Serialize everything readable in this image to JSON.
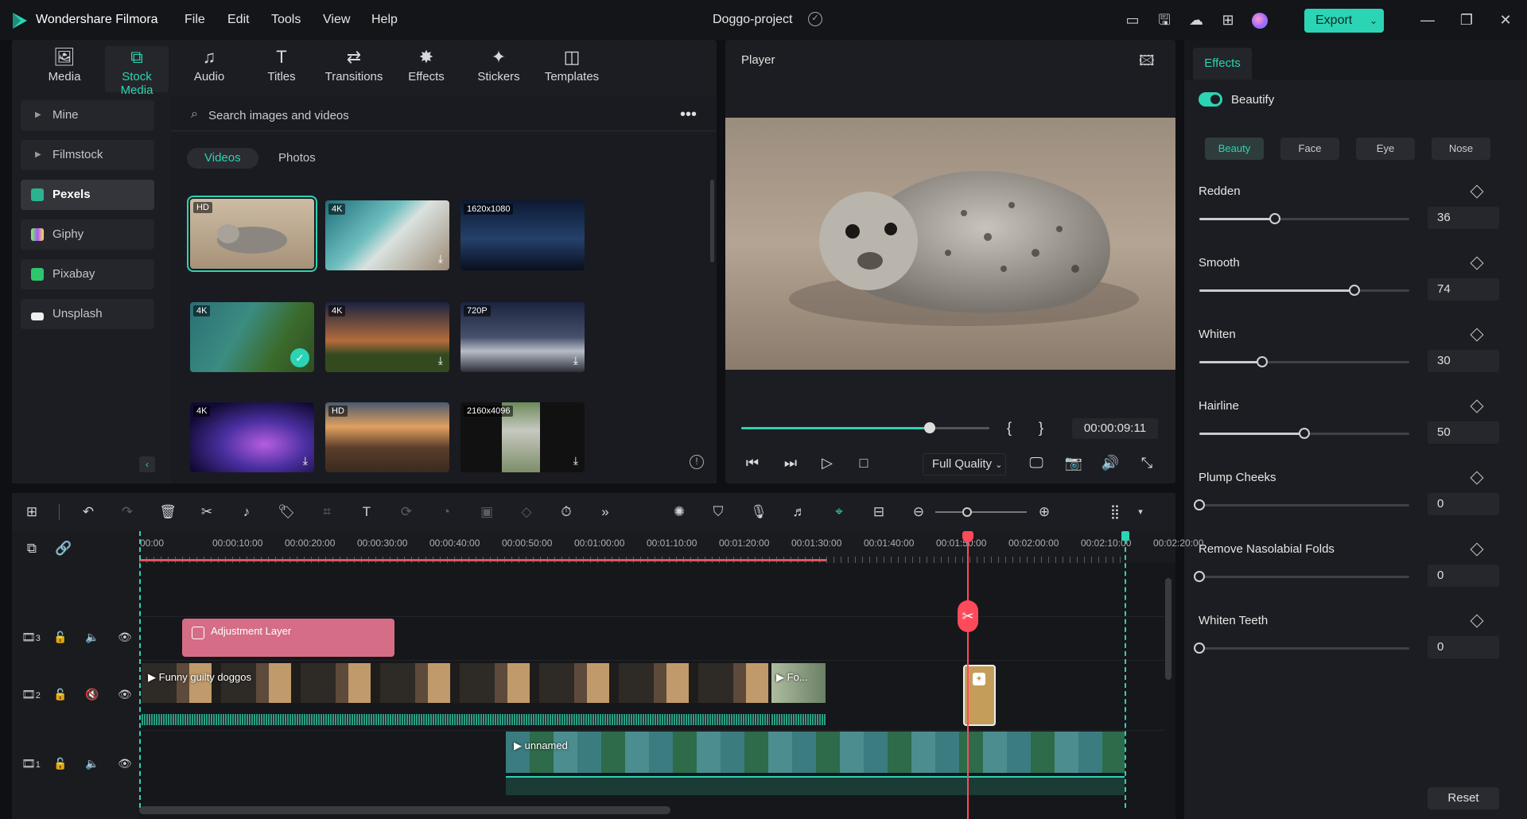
{
  "app": {
    "name": "Wondershare Filmora",
    "project": "Doggo-project"
  },
  "menu": [
    "File",
    "Edit",
    "Tools",
    "View",
    "Help"
  ],
  "toolbar": {
    "export_label": "Export"
  },
  "media_tabs": [
    {
      "label": "Media",
      "icon": "media-icon"
    },
    {
      "label": "Stock Media",
      "icon": "stock-media-icon"
    },
    {
      "label": "Audio",
      "icon": "music-note-icon"
    },
    {
      "label": "Titles",
      "icon": "titles-icon"
    },
    {
      "label": "Transitions",
      "icon": "transitions-icon"
    },
    {
      "label": "Effects",
      "icon": "effects-icon"
    },
    {
      "label": "Stickers",
      "icon": "stickers-icon"
    },
    {
      "label": "Templates",
      "icon": "templates-icon"
    }
  ],
  "sources": [
    {
      "label": "Mine"
    },
    {
      "label": "Filmstock"
    },
    {
      "label": "Pexels"
    },
    {
      "label": "Giphy"
    },
    {
      "label": "Pixabay"
    },
    {
      "label": "Unsplash"
    }
  ],
  "search": {
    "placeholder": "Search images and videos"
  },
  "subtabs": [
    "Videos",
    "Photos"
  ],
  "thumbnails": [
    {
      "badge": "HD"
    },
    {
      "badge": "4K"
    },
    {
      "badge": "1620x1080"
    },
    {
      "badge": "4K"
    },
    {
      "badge": "4K"
    },
    {
      "badge": "720P"
    },
    {
      "badge": "4K"
    },
    {
      "badge": "HD"
    },
    {
      "badge": "2160x4096"
    }
  ],
  "player": {
    "title": "Player",
    "timecode": "00:00:09:11",
    "quality": "Full Quality",
    "progress": 0.76,
    "brace_open": "{",
    "brace_close": "}"
  },
  "effects_panel": {
    "tab": "Effects",
    "beautify_label": "Beautify",
    "chips": [
      "Beauty",
      "Face",
      "Eye",
      "Nose"
    ],
    "sliders": [
      {
        "label": "Redden",
        "value": "36",
        "fraction": 0.36
      },
      {
        "label": "Smooth",
        "value": "74",
        "fraction": 0.74
      },
      {
        "label": "Whiten",
        "value": "30",
        "fraction": 0.3
      },
      {
        "label": "Hairline",
        "value": "50",
        "fraction": 0.5
      },
      {
        "label": "Plump Cheeks",
        "value": "0",
        "fraction": 0
      },
      {
        "label": "Remove Nasolabial Folds",
        "value": "0",
        "fraction": 0
      },
      {
        "label": "Whiten Teeth",
        "value": "0",
        "fraction": 0
      }
    ],
    "reset_label": "Reset"
  },
  "timeline": {
    "ruler_labels": [
      "00:00",
      "00:00:10:00",
      "00:00:20:00",
      "00:00:30:00",
      "00:00:40:00",
      "00:00:50:00",
      "00:01:00:00",
      "00:01:10:00",
      "00:01:20:00",
      "00:01:30:00",
      "00:01:40:00",
      "00:01:50:00",
      "00:02:00:00",
      "00:02:10:00",
      "00:02:20:00"
    ],
    "tracks": [
      {
        "num": "3"
      },
      {
        "num": "2"
      },
      {
        "num": "1"
      }
    ],
    "clips": {
      "adjustment": "Adjustment Layer",
      "funny": "Funny guilty doggos",
      "fo": "Fo...",
      "unnamed": "unnamed"
    }
  }
}
